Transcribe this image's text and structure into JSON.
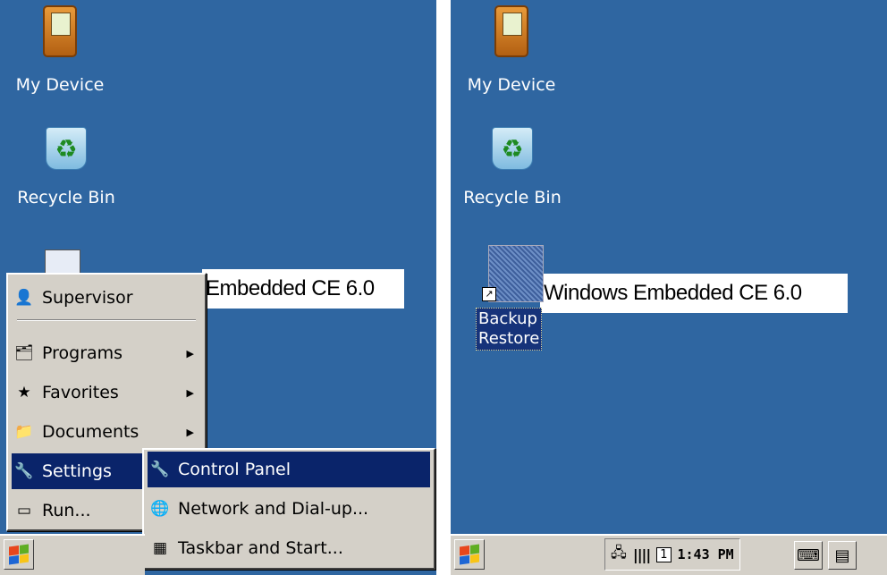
{
  "left": {
    "desktop": {
      "my_device": "My Device",
      "recycle_bin": "Recycle Bin",
      "ce_banner": "Embedded CE 6.0"
    },
    "start_menu": {
      "items": [
        {
          "label": "Supervisor",
          "icon": "supervisor-icon"
        },
        {
          "label": "Programs",
          "icon": "programs-icon",
          "submenu": true
        },
        {
          "label": "Favorites",
          "icon": "favorites-icon",
          "submenu": true
        },
        {
          "label": "Documents",
          "icon": "documents-icon",
          "submenu": true
        },
        {
          "label": "Settings",
          "icon": "settings-icon",
          "submenu": true,
          "selected": true
        },
        {
          "label": "Run...",
          "icon": "run-icon"
        }
      ]
    },
    "settings_submenu": {
      "items": [
        {
          "label": "Control Panel",
          "icon": "control-panel-icon",
          "selected": true
        },
        {
          "label": "Network and Dial-up...",
          "icon": "network-icon"
        },
        {
          "label": "Taskbar and Start...",
          "icon": "taskbar-icon"
        }
      ]
    }
  },
  "right": {
    "desktop": {
      "my_device": "My Device",
      "recycle_bin": "Recycle Bin",
      "ce_banner": "Windows Embedded CE 6.0",
      "backup_line1": "Backup",
      "backup_line2": "Restore"
    },
    "taskbar": {
      "clock": "1:43 PM",
      "input_indicator": "1"
    }
  },
  "colors": {
    "desktop": "#2f66a1",
    "menu_bg": "#d4d0c8",
    "selection": "#0a246a"
  }
}
